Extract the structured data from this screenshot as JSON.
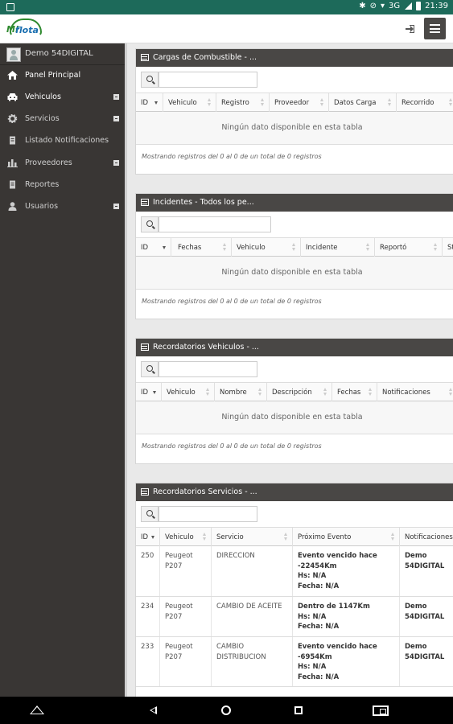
{
  "status_bar": {
    "time": "21:39",
    "network": "3G"
  },
  "header": {
    "logo_text_mi": "Mi",
    "logo_text_flota": "flota"
  },
  "sidebar": {
    "user": "Demo 54DIGITAL",
    "items": [
      {
        "label": "Panel Principal",
        "icon": "home-icon",
        "expandable": false
      },
      {
        "label": "Vehiculos",
        "icon": "car-icon",
        "expandable": true
      },
      {
        "label": "Servicios",
        "icon": "gear-icon",
        "expandable": true
      },
      {
        "label": "Listado Notificaciones",
        "icon": "clipboard-icon",
        "expandable": false
      },
      {
        "label": "Proveedores",
        "icon": "chart-icon",
        "expandable": true
      },
      {
        "label": "Reportes",
        "icon": "clipboard-icon",
        "expandable": false
      },
      {
        "label": "Usuarios",
        "icon": "user-icon",
        "expandable": true
      }
    ]
  },
  "panels": [
    {
      "title": "Cargas de Combustible - ...",
      "columns": [
        "ID",
        "Vehiculo",
        "Registro",
        "Proveedor",
        "Datos Carga",
        "Recorrido"
      ],
      "empty": "Ningún dato disponible en esta tabla",
      "info": "Mostrando registros del 0 al 0 de un total de 0 registros"
    },
    {
      "title": "Incidentes - Todos los pe...",
      "columns": [
        "ID",
        "Fechas",
        "Vehiculo",
        "Incidente",
        "Reportó",
        "St"
      ],
      "empty": "Ningún dato disponible en esta tabla",
      "info": "Mostrando registros del 0 al 0 de un total de 0 registros"
    },
    {
      "title": "Recordatorios Vehiculos - ...",
      "columns": [
        "ID",
        "Vehiculo",
        "Nombre",
        "Descripción",
        "Fechas",
        "Notificaciones"
      ],
      "empty": "Ningún dato disponible en esta tabla",
      "info": "Mostrando registros del 0 al 0 de un total de 0 registros"
    },
    {
      "title": "Recordatorios Servicios - ...",
      "columns": [
        "ID",
        "Vehiculo",
        "Servicio",
        "Próximo Evento",
        "Notificaciones"
      ],
      "rows": [
        {
          "id": "250",
          "vehiculo": [
            "Peugeot",
            "P207"
          ],
          "servicio": [
            "DIRECCION"
          ],
          "evento": [
            "Evento vencido hace",
            "-22454Km",
            "Hs: N/A",
            "Fecha: N/A"
          ],
          "notif": [
            "Demo",
            "54DIGITAL"
          ]
        },
        {
          "id": "234",
          "vehiculo": [
            "Peugeot",
            "P207"
          ],
          "servicio": [
            "CAMBIO DE ACEITE"
          ],
          "evento": [
            "Dentro de 1147Km",
            "Hs: N/A",
            "Fecha: N/A"
          ],
          "notif": [
            "Demo",
            "54DIGITAL"
          ]
        },
        {
          "id": "233",
          "vehiculo": [
            "Peugeot",
            "P207"
          ],
          "servicio": [
            "CAMBIO",
            "DISTRIBUCION"
          ],
          "evento": [
            "Evento vencido hace",
            "-6954Km",
            "Hs: N/A",
            "Fecha: N/A"
          ],
          "notif": [
            "Demo",
            "54DIGITAL"
          ]
        }
      ]
    }
  ]
}
